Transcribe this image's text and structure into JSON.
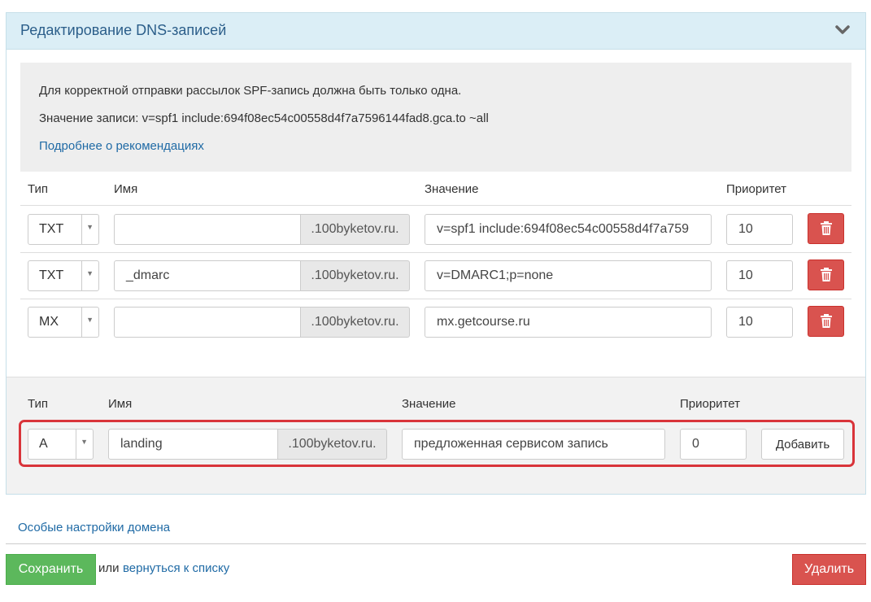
{
  "panel": {
    "title": "Редактирование DNS-записей",
    "collapse_icon": "chevron-down-icon"
  },
  "notice": {
    "line1": "Для корректной отправки рассылок SPF-запись должна быть только одна.",
    "line2": "Значение записи: v=spf1 include:694f08ec54c00558d4f7a7596144fad8.gca.to ~all",
    "link": "Подробнее о рекомендациях"
  },
  "table": {
    "headers": {
      "type": "Тип",
      "name": "Имя",
      "value": "Значение",
      "priority": "Приоритет"
    },
    "domain_suffix": ".100byketov.ru.",
    "rows": [
      {
        "type": "TXT",
        "name": "",
        "value": "v=spf1 include:694f08ec54c00558d4f7a759",
        "priority": "10"
      },
      {
        "type": "TXT",
        "name": "_dmarc",
        "value": "v=DMARC1;p=none",
        "priority": "10"
      },
      {
        "type": "MX",
        "name": "",
        "value": "mx.getcourse.ru",
        "priority": "10"
      }
    ],
    "delete_icon": "trash-icon"
  },
  "new_record": {
    "headers": {
      "type": "Тип",
      "name": "Имя",
      "value": "Значение",
      "priority": "Приоритет"
    },
    "type": "A",
    "name": "landing",
    "domain_suffix": ".100byketov.ru.",
    "value": "предложенная сервисом запись",
    "priority": "0",
    "add_label": "Добавить",
    "highlight_color": "#d9343a"
  },
  "footer": {
    "special_link": "Особые настройки домена",
    "save_label": "Сохранить",
    "or_text": "или",
    "back_link": "вернуться к списку",
    "delete_label": "Удалить"
  },
  "colors": {
    "header_bg": "#dbeef6",
    "link": "#1f6aa5",
    "success": "#5cb85c",
    "danger": "#d9534f"
  }
}
